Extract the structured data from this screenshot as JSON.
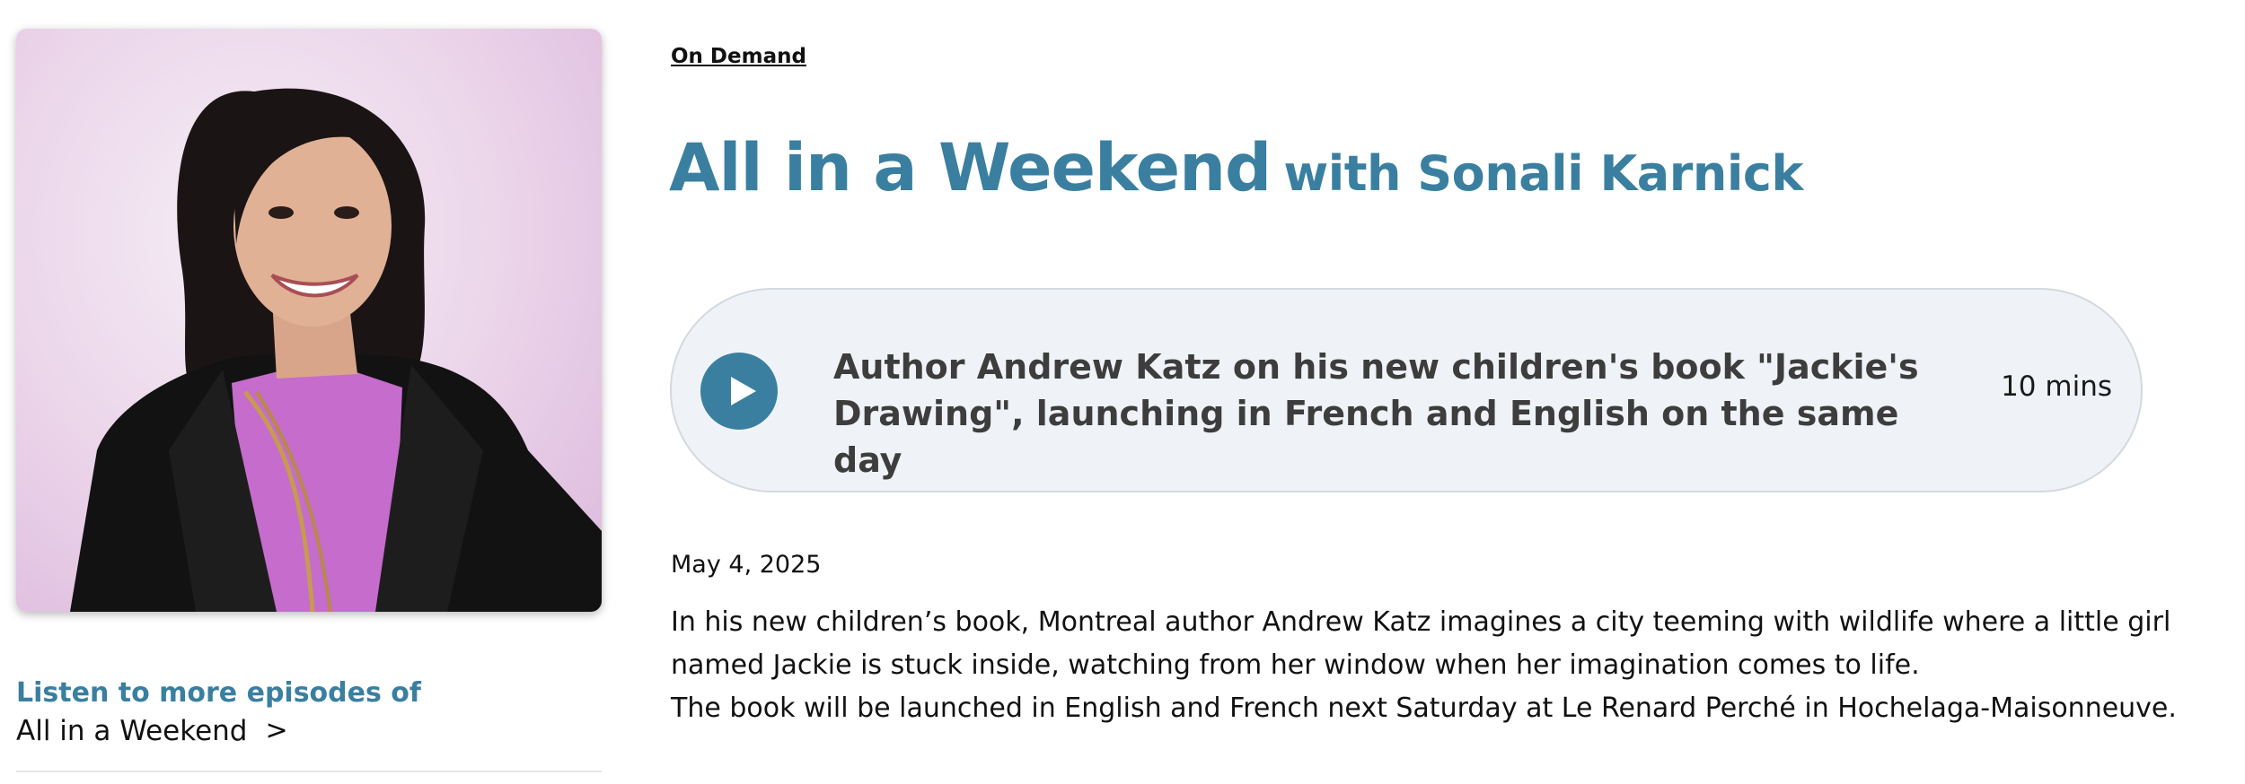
{
  "breadcrumb": {
    "label": "On Demand"
  },
  "show": {
    "title": "All in a Weekend",
    "host_line": "with Sonali Karnick"
  },
  "episode": {
    "title": "Author Andrew Katz on his new children's book \"Jackie's Drawing\", launching in French and English on the same day",
    "duration": "10 mins",
    "date": "May 4, 2025",
    "description": [
      "In his new children’s book, Montreal author Andrew Katz imagines a city teeming with wildlife where a little girl named Jackie is stuck inside, watching from her window when her imagination comes to life.",
      "The book will be launched in English and French next Saturday at Le Renard Perché in Hochelaga-Maisonneuve."
    ]
  },
  "sidebar": {
    "more_heading": "Listen to more episodes of",
    "more_link_label": "All in a Weekend",
    "more_link_chevron": ">"
  },
  "icons": {
    "play": "play-icon"
  },
  "colors": {
    "accent": "#3a7fa0",
    "pill_background": "#eff3f7",
    "pill_border": "#d3d9de"
  }
}
